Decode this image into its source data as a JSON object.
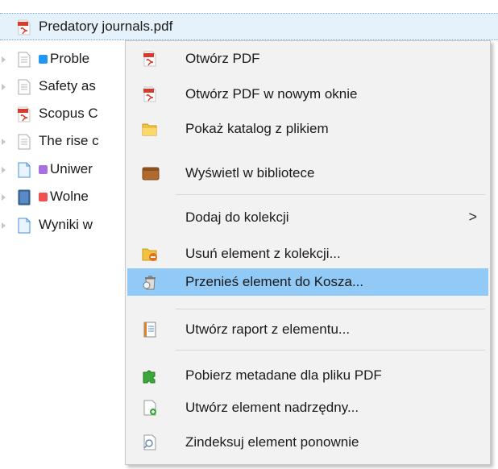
{
  "tree": {
    "items": [
      {
        "label": "Predatory journals.pdf",
        "icon": "pdf-icon",
        "dot": null,
        "selected": true
      },
      {
        "label": "Proble",
        "icon": "document-icon",
        "dot": "#2196f3"
      },
      {
        "label": "Safety as",
        "icon": "document-icon",
        "dot": null
      },
      {
        "label": "Scopus C",
        "icon": "pdf-icon",
        "dot": null
      },
      {
        "label": "The rise c",
        "icon": "document-icon",
        "dot": null
      },
      {
        "label": "Uniwer",
        "icon": "web-page-icon",
        "dot": "#a970e0"
      },
      {
        "label": "Wolne",
        "icon": "book-icon",
        "dot": "#f05050"
      },
      {
        "label": "Wyniki w",
        "icon": "web-page-icon",
        "dot": null
      }
    ]
  },
  "context_menu": {
    "items": [
      {
        "label": "Otwórz PDF",
        "icon": "pdf-icon"
      },
      {
        "label": "Otwórz PDF w nowym oknie",
        "icon": "pdf-icon"
      },
      {
        "label": "Pokaż katalog z plikiem",
        "icon": "folder-icon"
      },
      {
        "label": "Wyświetl w bibliotece",
        "icon": "library-icon"
      },
      {
        "label": "Dodaj do kolekcji",
        "icon": null,
        "submenu_arrow": ">"
      },
      {
        "label": "Usuń element z kolekcji...",
        "icon": "folder-remove-icon"
      },
      {
        "label": "Przenieś element do Kosza...",
        "icon": "trash-icon",
        "highlighted": true
      },
      {
        "label": "Utwórz raport z elementu...",
        "icon": "report-icon"
      },
      {
        "label": "Pobierz metadane dla pliku PDF",
        "icon": "puzzle-icon"
      },
      {
        "label": "Utwórz element nadrzędny...",
        "icon": "add-parent-icon"
      },
      {
        "label": "Zindeksuj element ponownie",
        "icon": "reindex-icon"
      }
    ]
  },
  "colors": {
    "selection_bg": "#e5f1fb",
    "menu_bg": "#f2f2f2",
    "menu_highlight": "#91c9f7"
  }
}
